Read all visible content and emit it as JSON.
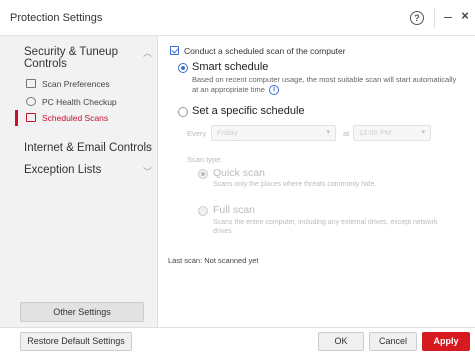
{
  "window": {
    "title": "Protection Settings",
    "help_glyph": "?",
    "minimize_glyph": "–",
    "close_glyph": "×"
  },
  "sidebar": {
    "sections": [
      {
        "label": "Security & Tuneup Controls",
        "expanded": true
      },
      {
        "label": "Internet & Email Controls",
        "expanded": false
      },
      {
        "label": "Exception Lists",
        "expanded": false
      }
    ],
    "items": [
      {
        "label": "Scan Preferences",
        "icon": "scan-preferences-icon",
        "active": false
      },
      {
        "label": "PC Health Checkup",
        "icon": "gauge-icon",
        "active": false
      },
      {
        "label": "Scheduled Scans",
        "icon": "calendar-icon",
        "active": true
      }
    ],
    "other_settings_label": "Other Settings"
  },
  "content": {
    "conduct_scan_label": "Conduct a scheduled scan of the computer",
    "conduct_scan_checked": true,
    "smart_schedule": {
      "label": "Smart schedule",
      "description": "Based on recent computer usage, the most suitable scan will start automatically at an appropriate time",
      "selected": true
    },
    "specific_schedule": {
      "label": "Set a specific schedule",
      "selected": false,
      "every_label": "Every",
      "every_value": "Friday",
      "at_label": "at",
      "time_value": "12:00 PM"
    },
    "scan_type": {
      "label": "Scan type:",
      "quick": {
        "label": "Quick scan",
        "description": "Scans only the places where threats commonly hide.",
        "selected": true
      },
      "full": {
        "label": "Full scan",
        "description": "Scans the entire computer, including any external drives, except network drives",
        "selected": false
      }
    },
    "last_scan": "Last scan: Not scanned yet"
  },
  "footer": {
    "restore_label": "Restore Default Settings",
    "ok_label": "OK",
    "cancel_label": "Cancel",
    "apply_label": "Apply"
  },
  "colors": {
    "accent_red": "#d71920",
    "link_blue": "#3b6fd1",
    "sidebar_bg": "#f2f2f2"
  }
}
